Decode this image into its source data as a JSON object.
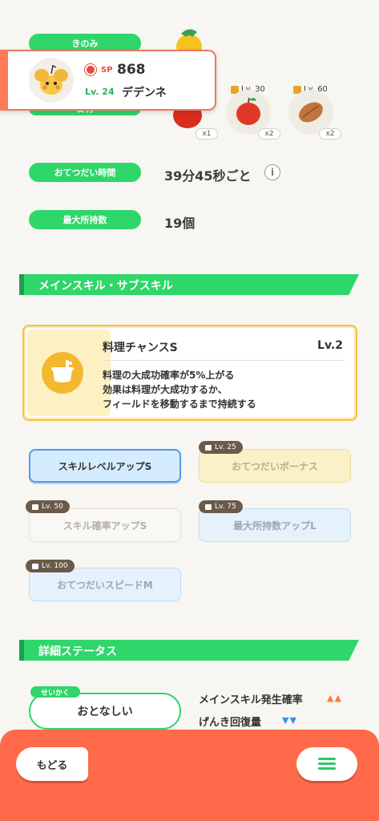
{
  "stats": {
    "berry_label": "きのみ",
    "berry_label_partial": "食材",
    "help_time_label": "おてつだい時間",
    "help_time_value": "39分45秒ごと",
    "max_carry_label": "最大所持数",
    "max_carry_value": "19個"
  },
  "ingredients": [
    {
      "count": "x1",
      "level": ""
    },
    {
      "count": "x2",
      "level": "Lv. 30"
    },
    {
      "count": "x2",
      "level": "Lv. 60"
    }
  ],
  "pokemon": {
    "sp_label": "SP",
    "sp_value": "868",
    "level": "Lv. 24",
    "name": "デデンネ"
  },
  "sections": {
    "skills_title": "メインスキル・サブスキル",
    "details_title": "詳細ステータス"
  },
  "main_skill": {
    "name": "料理チャンスS",
    "level": "Lv.2",
    "desc_line1": "料理の大成功確率が5%上がる",
    "desc_line2": "効果は料理が大成功するか、",
    "desc_line3": "フィールドを移動するまで持続する"
  },
  "sub_skills": [
    {
      "label": "スキルレベルアップS",
      "lock_level": ""
    },
    {
      "label": "おてつだいボーナス",
      "lock_level": "Lv. 25"
    },
    {
      "label": "スキル確率アップS",
      "lock_level": "Lv. 50"
    },
    {
      "label": "最大所持数アップL",
      "lock_level": "Lv. 75"
    },
    {
      "label": "おてつだいスピードM",
      "lock_level": "Lv. 100"
    }
  ],
  "nature": {
    "label": "せいかく",
    "value": "おとなしい",
    "up_effect": "メインスキル発生確率",
    "up_arrows": "▲▲",
    "down_effect": "げんき回復量",
    "down_arrows": "▼▼"
  },
  "bottom_bar": {
    "back_label": "もどる"
  },
  "colors": {
    "accent_green": "#2fd66a",
    "accent_orange": "#ff6b4a",
    "skill_gold": "#f3c24a",
    "active_blue": "#4a9bea"
  }
}
